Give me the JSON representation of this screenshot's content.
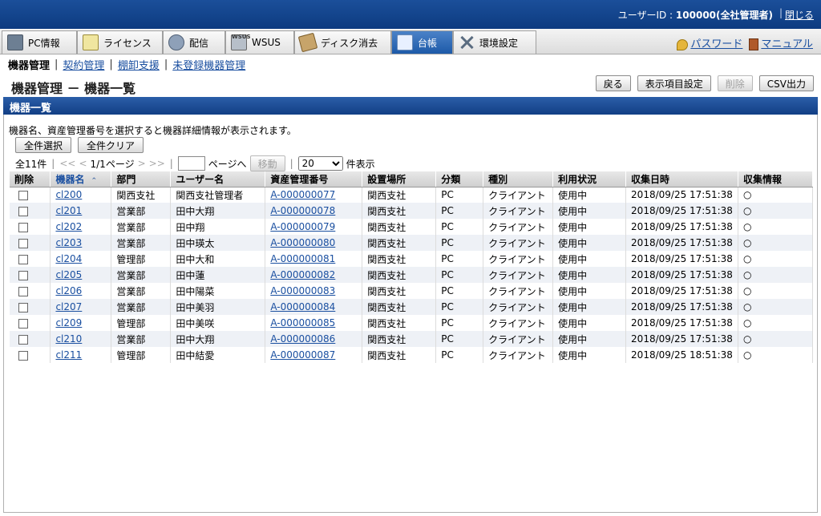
{
  "topbar": {
    "user_label": "ユーザーID : ",
    "user_value": "100000(全社管理者)",
    "close": "閉じる"
  },
  "tabs": [
    {
      "label": "PC情報",
      "icon": "pc-icon"
    },
    {
      "label": "ライセンス",
      "icon": "license-icon"
    },
    {
      "label": "配信",
      "icon": "distribution-icon"
    },
    {
      "label": "WSUS",
      "icon": "wsus-icon"
    },
    {
      "label": "ディスク消去",
      "icon": "disk-erase-icon"
    },
    {
      "label": "台帳",
      "icon": "ledger-icon"
    },
    {
      "label": "環境設定",
      "icon": "tools-icon"
    }
  ],
  "wsus_tag": "WSUS",
  "links": {
    "password": "パスワード",
    "manual": "マニュアル"
  },
  "subnav": {
    "current": "機器管理",
    "items": [
      "契約管理",
      "棚卸支援",
      "未登録機器管理"
    ]
  },
  "page_title": "機器管理 － 機器一覧",
  "actions": {
    "back": "戻る",
    "display": "表示項目設定",
    "delete": "削除",
    "csv": "CSV出力"
  },
  "section_title": "機器一覧",
  "help_text": "機器名、資産管理番号を選択すると機器詳細情報が表示されます。",
  "select_all": "全件選択",
  "clear_all": "全件クリア",
  "pager": {
    "total": "全11件",
    "first": "<<",
    "prev": "<",
    "page": "1/1ページ",
    "next": ">",
    "last": ">>",
    "goto_suffix": "ページへ",
    "move": "移動",
    "per_page": "20",
    "per_page_suffix": "件表示"
  },
  "columns": [
    "削除",
    "機器名",
    "部門",
    "ユーザー名",
    "資産管理番号",
    "設置場所",
    "分類",
    "種別",
    "利用状況",
    "収集日時",
    "収集情報"
  ],
  "rows": [
    {
      "name": "cl200",
      "dept": "関西支社",
      "user": "関西支社管理者",
      "asset": "A-000000077",
      "place": "関西支社",
      "cls": "PC",
      "kind": "クライアント",
      "status": "使用中",
      "date": "2018/09/25 17:51:38",
      "info": "○"
    },
    {
      "name": "cl201",
      "dept": "営業部",
      "user": "田中大翔",
      "asset": "A-000000078",
      "place": "関西支社",
      "cls": "PC",
      "kind": "クライアント",
      "status": "使用中",
      "date": "2018/09/25 17:51:38",
      "info": "○"
    },
    {
      "name": "cl202",
      "dept": "営業部",
      "user": "田中翔",
      "asset": "A-000000079",
      "place": "関西支社",
      "cls": "PC",
      "kind": "クライアント",
      "status": "使用中",
      "date": "2018/09/25 17:51:38",
      "info": "○"
    },
    {
      "name": "cl203",
      "dept": "営業部",
      "user": "田中瑛太",
      "asset": "A-000000080",
      "place": "関西支社",
      "cls": "PC",
      "kind": "クライアント",
      "status": "使用中",
      "date": "2018/09/25 17:51:38",
      "info": "○"
    },
    {
      "name": "cl204",
      "dept": "管理部",
      "user": "田中大和",
      "asset": "A-000000081",
      "place": "関西支社",
      "cls": "PC",
      "kind": "クライアント",
      "status": "使用中",
      "date": "2018/09/25 17:51:38",
      "info": "○"
    },
    {
      "name": "cl205",
      "dept": "営業部",
      "user": "田中蓮",
      "asset": "A-000000082",
      "place": "関西支社",
      "cls": "PC",
      "kind": "クライアント",
      "status": "使用中",
      "date": "2018/09/25 17:51:38",
      "info": "○"
    },
    {
      "name": "cl206",
      "dept": "営業部",
      "user": "田中陽菜",
      "asset": "A-000000083",
      "place": "関西支社",
      "cls": "PC",
      "kind": "クライアント",
      "status": "使用中",
      "date": "2018/09/25 17:51:38",
      "info": "○"
    },
    {
      "name": "cl207",
      "dept": "営業部",
      "user": "田中美羽",
      "asset": "A-000000084",
      "place": "関西支社",
      "cls": "PC",
      "kind": "クライアント",
      "status": "使用中",
      "date": "2018/09/25 17:51:38",
      "info": "○"
    },
    {
      "name": "cl209",
      "dept": "管理部",
      "user": "田中美咲",
      "asset": "A-000000085",
      "place": "関西支社",
      "cls": "PC",
      "kind": "クライアント",
      "status": "使用中",
      "date": "2018/09/25 17:51:38",
      "info": "○"
    },
    {
      "name": "cl210",
      "dept": "営業部",
      "user": "田中大翔",
      "asset": "A-000000086",
      "place": "関西支社",
      "cls": "PC",
      "kind": "クライアント",
      "status": "使用中",
      "date": "2018/09/25 17:51:38",
      "info": "○"
    },
    {
      "name": "cl211",
      "dept": "管理部",
      "user": "田中結愛",
      "asset": "A-000000087",
      "place": "関西支社",
      "cls": "PC",
      "kind": "クライアント",
      "status": "使用中",
      "date": "2018/09/25 18:51:38",
      "info": "○"
    }
  ]
}
